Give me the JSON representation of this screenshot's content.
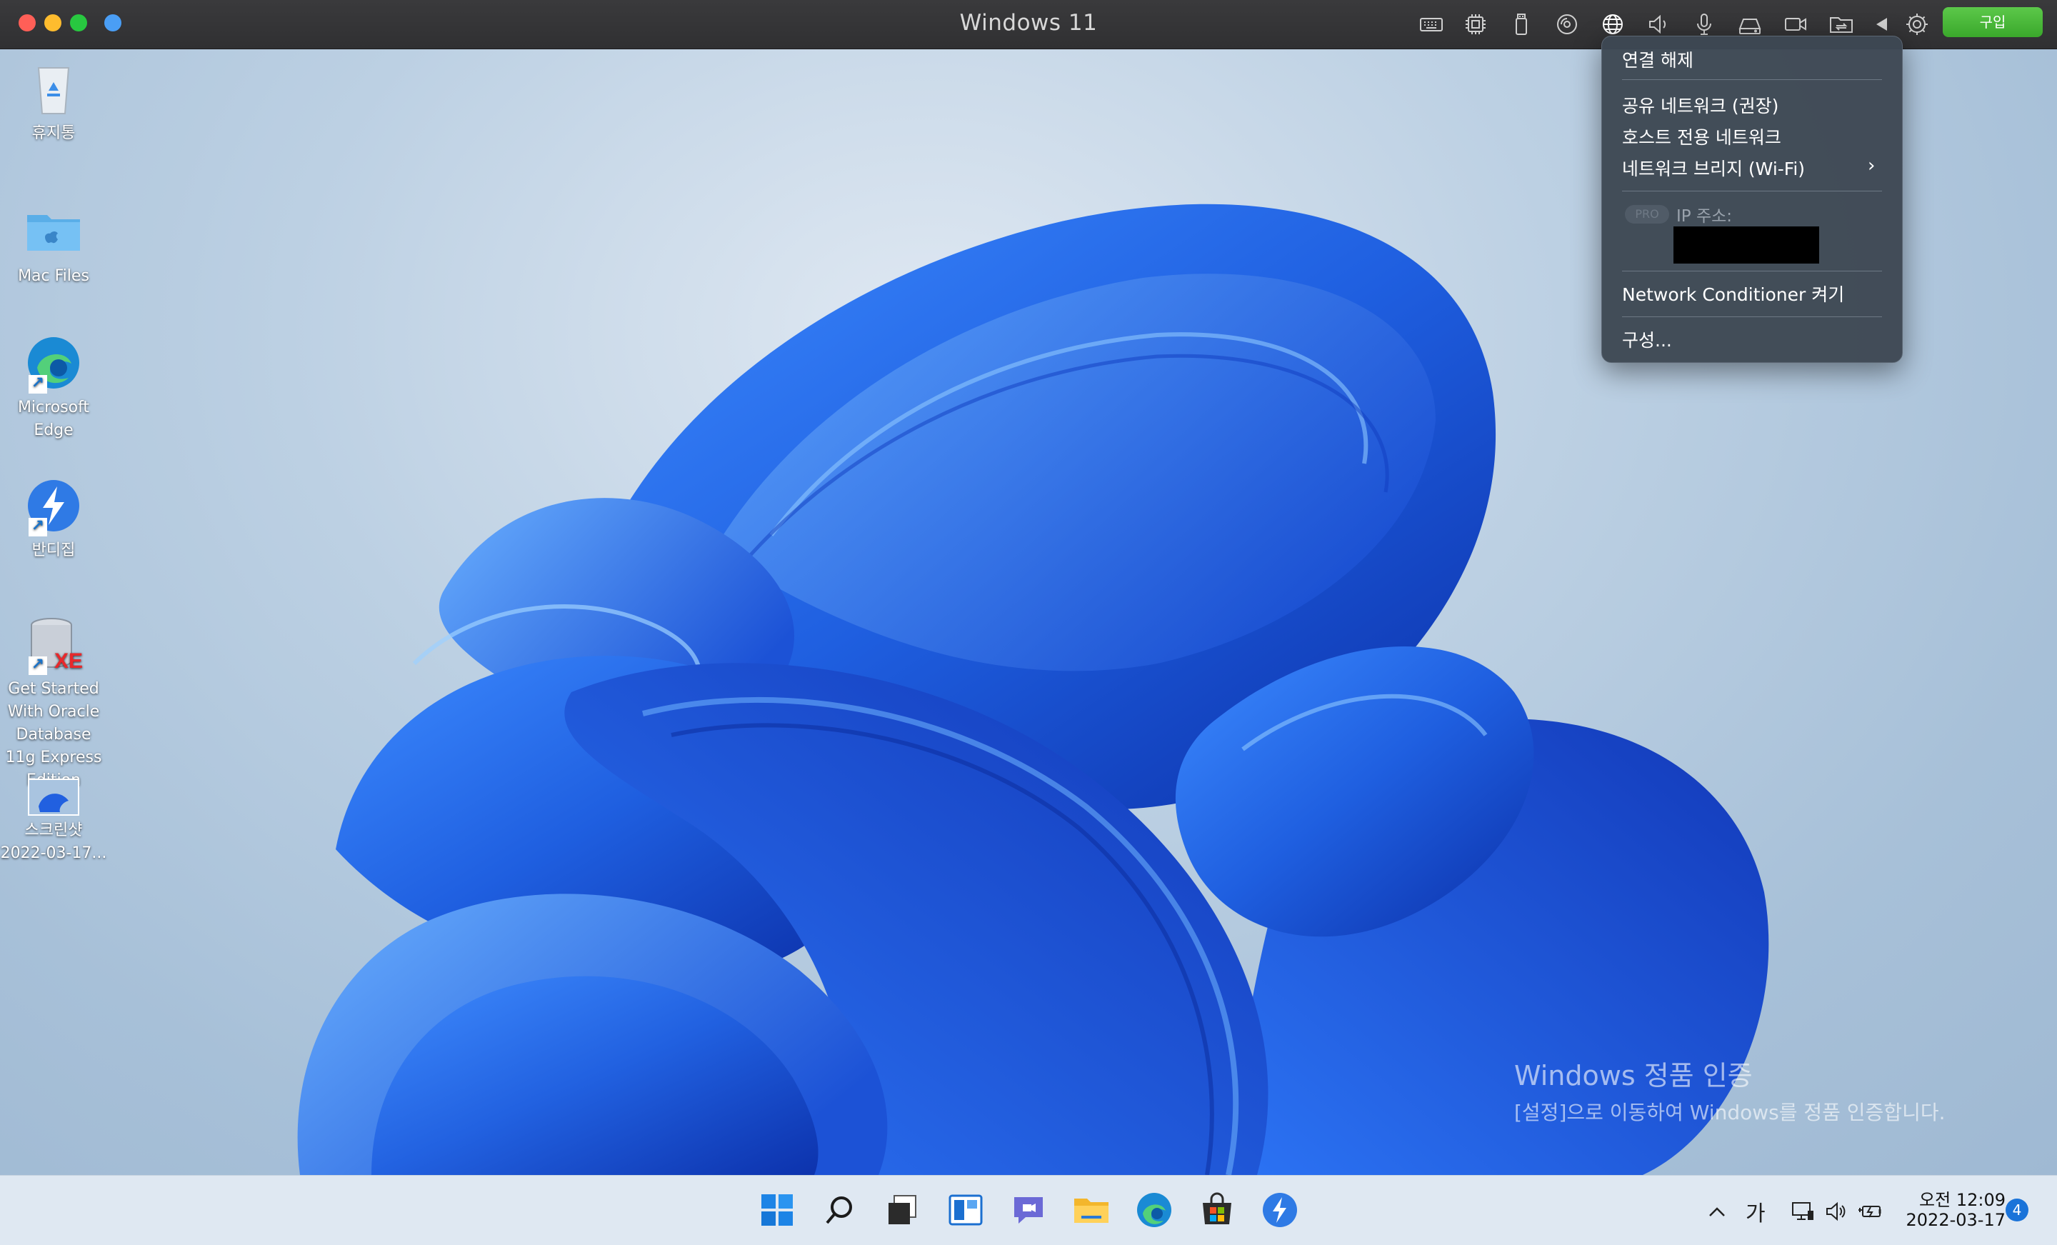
{
  "window": {
    "title": "Windows 11",
    "buy_label": "구입"
  },
  "titlebar_icons": [
    "keyboard-icon",
    "cpu-icon",
    "usb-icon",
    "cd-icon",
    "globe-network-icon",
    "speaker-icon",
    "microphone-icon",
    "drive-icon",
    "camera-icon",
    "shared-folder-icon",
    "arrow-left-icon",
    "gear-icon"
  ],
  "desktop_icons": [
    {
      "label": "휴지통"
    },
    {
      "label": "Mac Files"
    },
    {
      "label": "Microsoft Edge"
    },
    {
      "label": "반디집"
    },
    {
      "label": "Get Started With Oracle Database 11g Express Edition"
    },
    {
      "label": "스크린샷 2022-03-17..."
    }
  ],
  "network_menu": {
    "disconnect": "연결 해제",
    "shared": "공유 네트워크 (권장)",
    "host_only": "호스트 전용 네트워크",
    "bridge": "네트워크 브리지 (Wi-Fi)",
    "pill": "PRO",
    "ip_label": "IP 주소:",
    "conditioner": "Network Conditioner 켜기",
    "configure": "구성..."
  },
  "activation": {
    "title": "Windows 정품 인증",
    "subtitle": "[설정]으로 이동하여 Windows를 정품 인증합니다."
  },
  "taskbar": {
    "apps": [
      "windows-start-icon",
      "search-icon",
      "task-view-icon",
      "widgets-icon",
      "teams-chat-icon",
      "file-explorer-icon",
      "edge-icon",
      "store-icon",
      "bandizip-icon"
    ],
    "ime": "가",
    "time": "오전 12:09",
    "date": "2022-03-17",
    "notifications": "4"
  },
  "colors": {
    "accent_blue": "#1a73d9",
    "buy_green": "#3aa82b",
    "menu_bg": "#3e4854"
  }
}
